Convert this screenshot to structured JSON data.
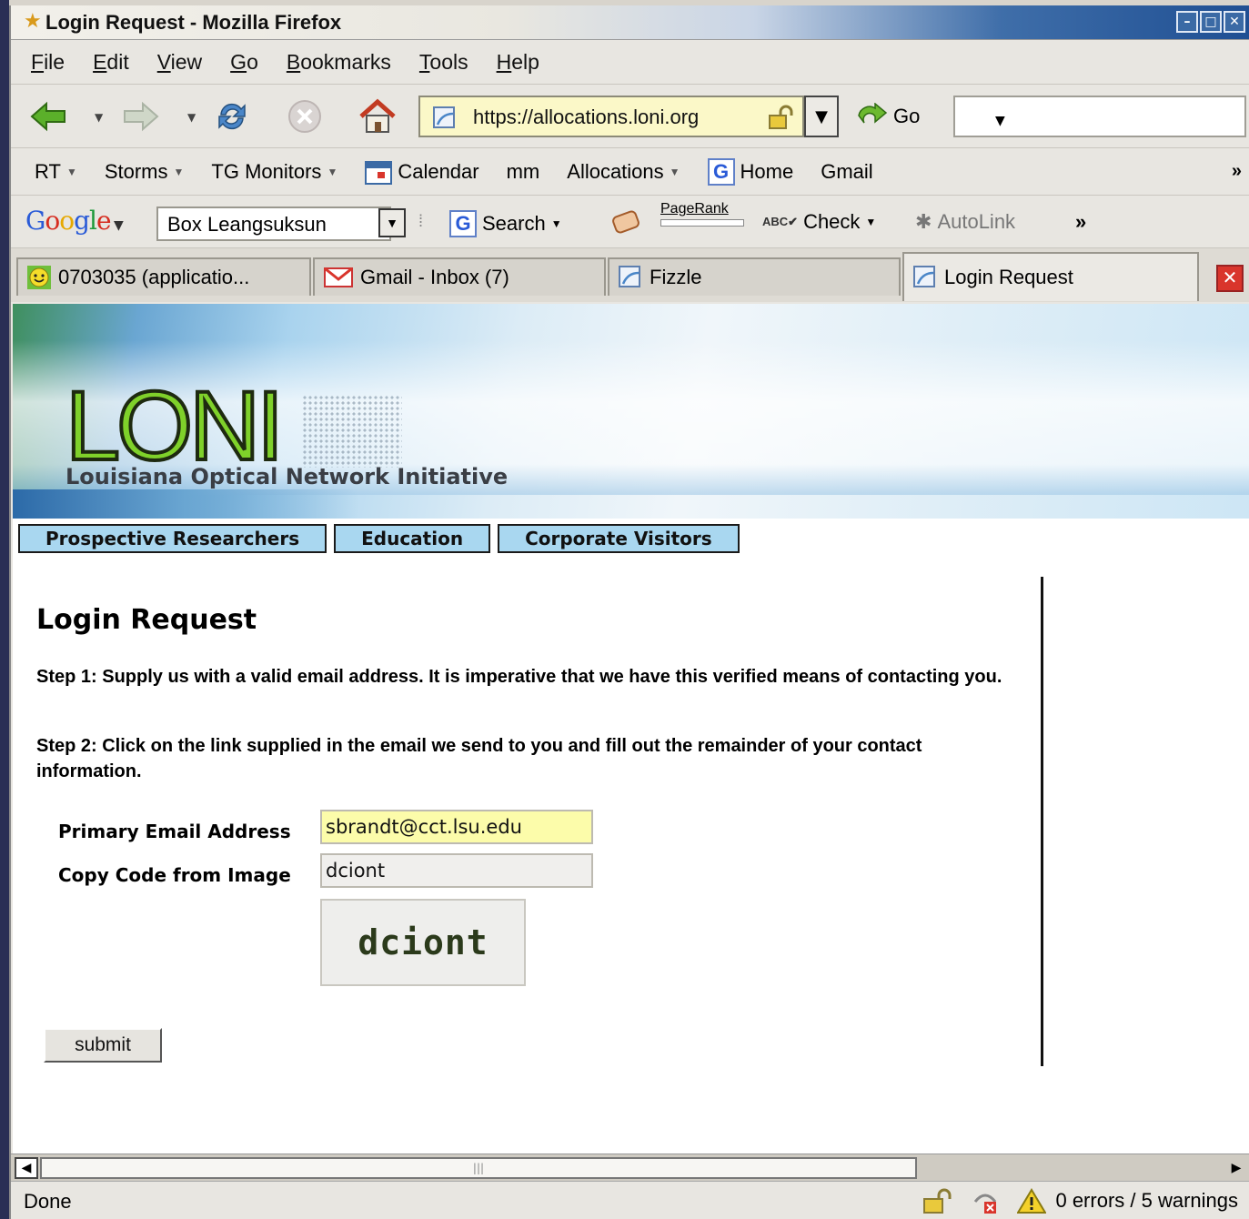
{
  "window": {
    "title": "Login Request - Mozilla Firefox",
    "buttons": [
      "minimize",
      "maximize",
      "close"
    ]
  },
  "menubar": [
    "File",
    "Edit",
    "View",
    "Go",
    "Bookmarks",
    "Tools",
    "Help"
  ],
  "navbar": {
    "url": "https://allocations.loni.org",
    "go_label": "Go",
    "search_value": ""
  },
  "bookmarks": [
    {
      "label": "RT",
      "dropdown": true
    },
    {
      "label": "Storms",
      "dropdown": true
    },
    {
      "label": "TG Monitors",
      "dropdown": true
    },
    {
      "label": "Calendar",
      "icon": "calendar-icon"
    },
    {
      "label": "mm"
    },
    {
      "label": "Allocations",
      "dropdown": true
    },
    {
      "label": "Home",
      "icon": "google-g-icon"
    },
    {
      "label": "Gmail"
    }
  ],
  "google_toolbar": {
    "logo": "Google",
    "query": "Box Leangsuksun",
    "search_label": "Search",
    "pagerank_label": "PageRank",
    "check_label": "Check",
    "autolink_label": "AutoLink"
  },
  "tabs": [
    {
      "label": "0703035 (applicatio...",
      "icon": "smiley-icon"
    },
    {
      "label": "Gmail - Inbox (7)",
      "icon": "gmail-icon"
    },
    {
      "label": "Fizzle",
      "icon": "page-icon"
    },
    {
      "label": "Login Request",
      "icon": "page-icon",
      "active": true
    }
  ],
  "banner": {
    "logo": "LONI",
    "subtitle": "Louisiana Optical Network Initiative"
  },
  "site_nav": [
    "Prospective Researchers",
    "Education",
    "Corporate Visitors"
  ],
  "page": {
    "title": "Login Request",
    "step1": "Step 1: Supply us with a valid email address. It is imperative that we have this verified means of contacting you.",
    "step2": "Step 2: Click on the link supplied in the email we send to you and fill out the remainder of your contact information.",
    "email_label": "Primary Email Address",
    "email_value": "sbrandt@cct.lsu.edu",
    "code_label": "Copy Code from Image",
    "code_value": "dciont",
    "captcha_text": "dciont",
    "submit_label": "submit"
  },
  "statusbar": {
    "status": "Done",
    "errors": "0 errors / 5 warnings"
  },
  "colors": {
    "url_bg": "#fbf8c8",
    "email_bg": "#fcfcaa",
    "nav_tab_bg": "#a9d7f0",
    "loni_green": "#7fd12a"
  }
}
